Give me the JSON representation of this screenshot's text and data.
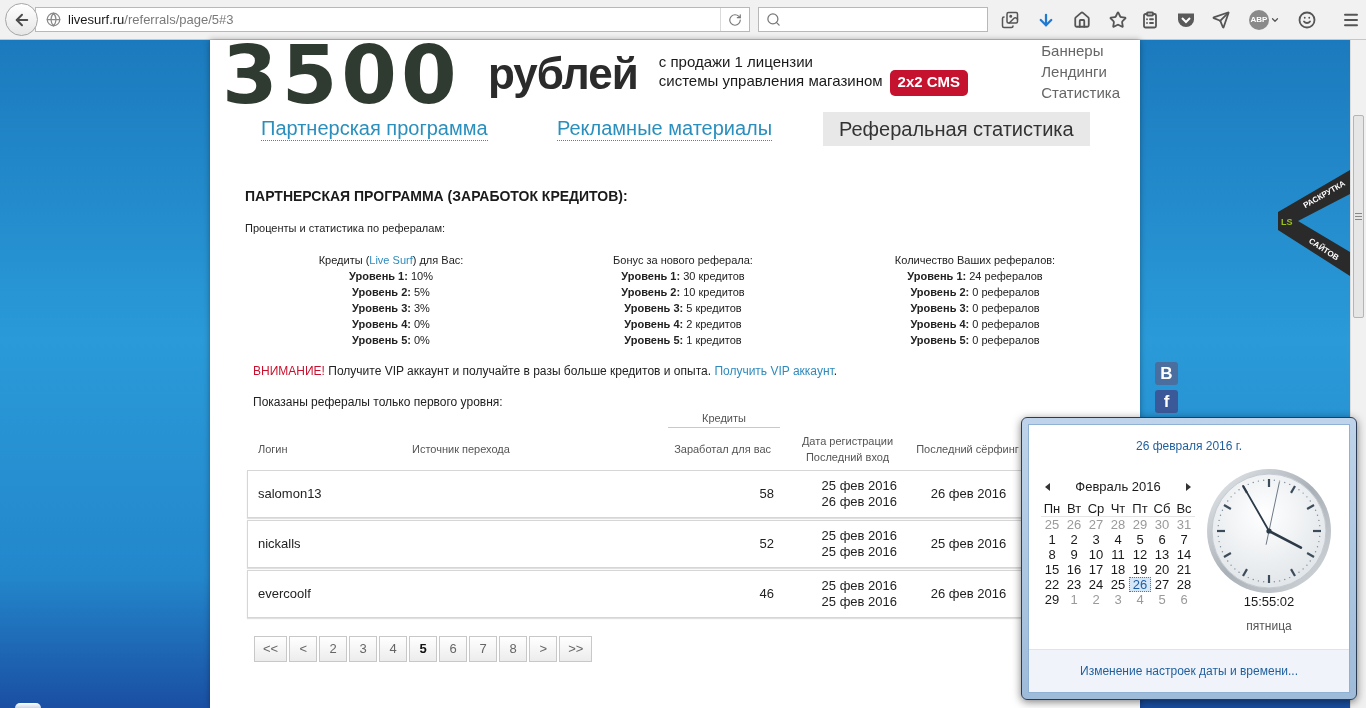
{
  "browser": {
    "url_host": "livesurf.ru",
    "url_path": "/referrals/page/5#3",
    "extension_label": "ABP"
  },
  "header": {
    "amount": "3500",
    "currency": "рублей",
    "tagline": [
      "с продажи 1 лицензии",
      "системы управления магазином"
    ],
    "badge": "2x2 CMS",
    "menu": [
      "Баннеры",
      "Лендинги",
      "Статистика"
    ]
  },
  "tabs": [
    {
      "label": "Партнерская программа",
      "selected": false
    },
    {
      "label": "Рекламные материалы",
      "selected": false
    },
    {
      "label": "Реферальная статистика",
      "selected": true
    }
  ],
  "section": {
    "title": "ПАРТНЕРСКАЯ ПРОГРАММА (ЗАРАБОТОК КРЕДИТОВ):",
    "subtitle": "Проценты и статистика по рефералам:",
    "columns": [
      {
        "heading": {
          "before": "Кредиты (",
          "link": "Live Surf",
          "after": ") для Вас:"
        },
        "levels": [
          "**Уровень 1:** 10%",
          "**Уровень 2:** 5%",
          "**Уровень 3:** 3%",
          "**Уровень 4:** 0%",
          "**Уровень 5:** 0%"
        ]
      },
      {
        "heading": {
          "before": "Бонус за нового реферала:"
        },
        "levels": [
          "**Уровень 1:** 30 кредитов",
          "**Уровень 2:** 10 кредитов",
          "**Уровень 3:** 5 кредитов",
          "**Уровень 4:** 2 кредитов",
          "**Уровень 5:** 1 кредитов"
        ]
      },
      {
        "heading": {
          "before": "Количество Ваших рефералов:"
        },
        "levels": [
          "**Уровень 1:** 24 рефералов",
          "**Уровень 2:** 0 рефералов",
          "**Уровень 3:** 0 рефералов",
          "**Уровень 4:** 0 рефералов",
          "**Уровень 5:** 0 рефералов"
        ]
      }
    ]
  },
  "notice": {
    "alert": "ВНИМАНИЕ!",
    "text": "Получите VIP аккаунт и получайте в разы больше кредитов и опыта.",
    "link": "Получить VIP аккаунт",
    "end": "."
  },
  "table": {
    "caption": "Показаны рефералы только первого уровня:",
    "group_header": "Кредиты",
    "columns": [
      [
        "Логин"
      ],
      [
        "Источник перехода"
      ],
      [
        "Заработал для вас"
      ],
      [
        "Дата регистрации",
        "Последний вход"
      ],
      [
        "Последний сёрфинг"
      ]
    ],
    "rows": [
      {
        "login": "salomon13",
        "earned": "58",
        "registered": "25 фев 2016",
        "last_login": "26 фев 2016",
        "last_surf": "26 фев 2016"
      },
      {
        "login": "nickalls",
        "earned": "52",
        "registered": "25 фев 2016",
        "last_login": "25 фев 2016",
        "last_surf": "25 фев 2016"
      },
      {
        "login": "evercoolf",
        "earned": "46",
        "registered": "25 фев 2016",
        "last_login": "25 фев 2016",
        "last_surf": "26 фев 2016"
      }
    ]
  },
  "pagination": [
    {
      "label": "<<",
      "selected": false
    },
    {
      "label": "<",
      "selected": false
    },
    {
      "label": "2",
      "selected": false
    },
    {
      "label": "3",
      "selected": false
    },
    {
      "label": "4",
      "selected": false
    },
    {
      "label": "5",
      "selected": true
    },
    {
      "label": "6",
      "selected": false
    },
    {
      "label": "7",
      "selected": false
    },
    {
      "label": "8",
      "selected": false
    },
    {
      "label": ">",
      "selected": false
    },
    {
      "label": ">>",
      "selected": false
    }
  ],
  "ribbon": {
    "logo": "LS",
    "line_1": "РАСКРУТКА",
    "line_2": "САЙТОВ"
  },
  "social": [
    {
      "glyph": "B",
      "color": "#4a6e9e"
    },
    {
      "glyph": "f",
      "color": "#3b5998"
    }
  ],
  "clock_popup": {
    "date": "26 февраля 2016 г.",
    "month": "Февраль 2016",
    "weekdays": [
      "Пн",
      "Вт",
      "Ср",
      "Чт",
      "Пт",
      "Сб",
      "Вс"
    ],
    "weeks": [
      [
        {
          "day": "25",
          "other_month": true,
          "selected": false
        },
        {
          "day": "26",
          "other_month": true,
          "selected": false
        },
        {
          "day": "27",
          "other_month": true,
          "selected": false
        },
        {
          "day": "28",
          "other_month": true,
          "selected": false
        },
        {
          "day": "29",
          "other_month": true,
          "selected": false
        },
        {
          "day": "30",
          "other_month": true,
          "selected": false
        },
        {
          "day": "31",
          "other_month": true,
          "selected": false
        }
      ],
      [
        {
          "day": "1",
          "other_month": false,
          "selected": false
        },
        {
          "day": "2",
          "other_month": false,
          "selected": false
        },
        {
          "day": "3",
          "other_month": false,
          "selected": false
        },
        {
          "day": "4",
          "other_month": false,
          "selected": false
        },
        {
          "day": "5",
          "other_month": false,
          "selected": false
        },
        {
          "day": "6",
          "other_month": false,
          "selected": false
        },
        {
          "day": "7",
          "other_month": false,
          "selected": false
        }
      ],
      [
        {
          "day": "8",
          "other_month": false,
          "selected": false
        },
        {
          "day": "9",
          "other_month": false,
          "selected": false
        },
        {
          "day": "10",
          "other_month": false,
          "selected": false
        },
        {
          "day": "11",
          "other_month": false,
          "selected": false
        },
        {
          "day": "12",
          "other_month": false,
          "selected": false
        },
        {
          "day": "13",
          "other_month": false,
          "selected": false
        },
        {
          "day": "14",
          "other_month": false,
          "selected": false
        }
      ],
      [
        {
          "day": "15",
          "other_month": false,
          "selected": false
        },
        {
          "day": "16",
          "other_month": false,
          "selected": false
        },
        {
          "day": "17",
          "other_month": false,
          "selected": false
        },
        {
          "day": "18",
          "other_month": false,
          "selected": false
        },
        {
          "day": "19",
          "other_month": false,
          "selected": false
        },
        {
          "day": "20",
          "other_month": false,
          "selected": false
        },
        {
          "day": "21",
          "other_month": false,
          "selected": false
        }
      ],
      [
        {
          "day": "22",
          "other_month": false,
          "selected": false
        },
        {
          "day": "23",
          "other_month": false,
          "selected": false
        },
        {
          "day": "24",
          "other_month": false,
          "selected": false
        },
        {
          "day": "25",
          "other_month": false,
          "selected": false
        },
        {
          "day": "26",
          "other_month": false,
          "selected": true
        },
        {
          "day": "27",
          "other_month": false,
          "selected": false
        },
        {
          "day": "28",
          "other_month": false,
          "selected": false
        }
      ],
      [
        {
          "day": "29",
          "other_month": false,
          "selected": false
        },
        {
          "day": "1",
          "other_month": true,
          "selected": false
        },
        {
          "day": "2",
          "other_month": true,
          "selected": false
        },
        {
          "day": "3",
          "other_month": true,
          "selected": false
        },
        {
          "day": "4",
          "other_month": true,
          "selected": false
        },
        {
          "day": "5",
          "other_month": true,
          "selected": false
        },
        {
          "day": "6",
          "other_month": true,
          "selected": false
        }
      ]
    ],
    "time": "15:55:02",
    "weekday": "пятница",
    "settings_link": "Изменение настроек даты и времени..."
  }
}
